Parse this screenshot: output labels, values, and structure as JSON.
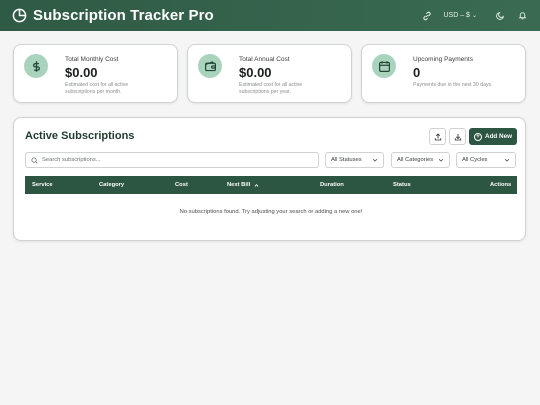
{
  "header": {
    "title": "Subscription Tracker Pro",
    "logo_icon": "pie-chart-icon",
    "currency_label": "USD – $",
    "icons": [
      "link-icon",
      "moon-icon",
      "bell-icon"
    ]
  },
  "cards": [
    {
      "label": "Total Monthly Cost",
      "value": "$0.00",
      "desc": "Estimated cost for all active subscriptions per month.",
      "icon": "dollar-icon"
    },
    {
      "label": "Total Annual Cost",
      "value": "$0.00",
      "desc": "Estimated cost for all active subscriptions per year.",
      "icon": "wallet-icon"
    },
    {
      "label": "Upcoming Payments",
      "value": "0",
      "desc": "Payments due in the next 30 days.",
      "icon": "calendar-icon"
    }
  ],
  "subscriptions": {
    "title": "Active Subscriptions",
    "add_label": "Add New",
    "search_placeholder": "Search subscriptions...",
    "filters": {
      "status": "All Statuses",
      "category": "All Categories",
      "cycle": "All Cycles"
    },
    "columns": [
      "Service",
      "Category",
      "Cost",
      "Next Bill",
      "Duration",
      "Status",
      "Actions"
    ],
    "empty_message": "No subscriptions found. Try adjusting your search or adding a new one!"
  },
  "colors": {
    "primary": "#2d5642",
    "accent_soft": "#a9d3bd",
    "background": "#f4f5f4"
  }
}
